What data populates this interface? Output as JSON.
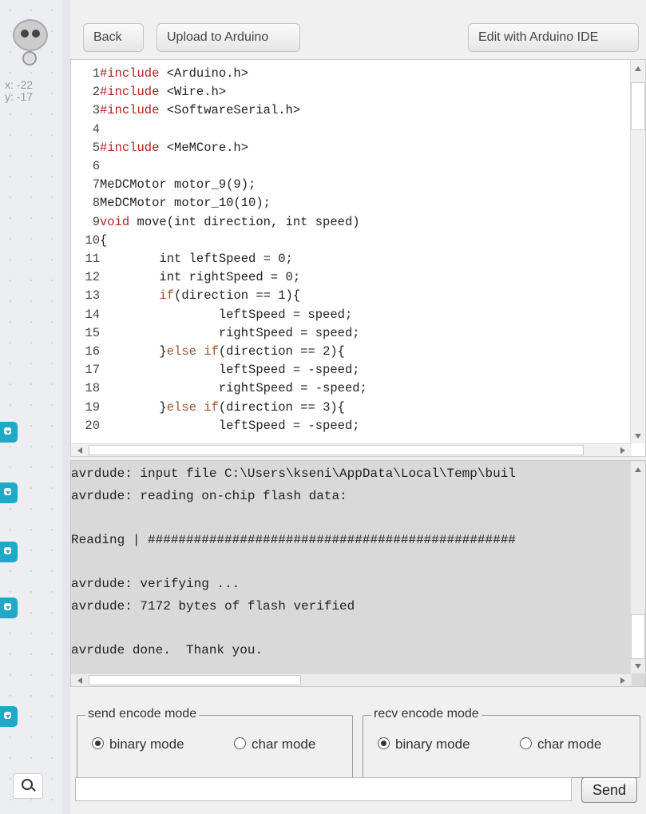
{
  "sprite": {
    "x_readout": "x: -22",
    "y_readout": "y: -17"
  },
  "toolbar": {
    "back_label": "Back",
    "upload_label": "Upload to Arduino",
    "edit_label": "Edit with Arduino IDE"
  },
  "code_lines": [
    {
      "n": "1",
      "tokens": [
        {
          "t": "#include",
          "c": "kw"
        },
        {
          "t": " <Arduino.h>",
          "c": ""
        }
      ]
    },
    {
      "n": "2",
      "tokens": [
        {
          "t": "#include",
          "c": "kw"
        },
        {
          "t": " <Wire.h>",
          "c": ""
        }
      ]
    },
    {
      "n": "3",
      "tokens": [
        {
          "t": "#include",
          "c": "kw"
        },
        {
          "t": " <SoftwareSerial.h>",
          "c": ""
        }
      ]
    },
    {
      "n": "4",
      "tokens": []
    },
    {
      "n": "5",
      "tokens": [
        {
          "t": "#include",
          "c": "kw"
        },
        {
          "t": " <MeMCore.h>",
          "c": ""
        }
      ]
    },
    {
      "n": "6",
      "tokens": []
    },
    {
      "n": "7",
      "tokens": [
        {
          "t": "MeDCMotor motor_9(9);",
          "c": ""
        }
      ]
    },
    {
      "n": "8",
      "tokens": [
        {
          "t": "MeDCMotor motor_10(10);",
          "c": ""
        }
      ]
    },
    {
      "n": "9",
      "tokens": [
        {
          "t": "void",
          "c": "kw"
        },
        {
          "t": " move(int direction, int speed)",
          "c": ""
        }
      ]
    },
    {
      "n": "10",
      "tokens": [
        {
          "t": "{",
          "c": ""
        }
      ]
    },
    {
      "n": "11",
      "tokens": [
        {
          "t": "        int leftSpeed = 0;",
          "c": ""
        }
      ]
    },
    {
      "n": "12",
      "tokens": [
        {
          "t": "        int rightSpeed = 0;",
          "c": ""
        }
      ]
    },
    {
      "n": "13",
      "tokens": [
        {
          "t": "        ",
          "c": ""
        },
        {
          "t": "if",
          "c": "ctl"
        },
        {
          "t": "(direction == 1){",
          "c": ""
        }
      ]
    },
    {
      "n": "14",
      "tokens": [
        {
          "t": "                leftSpeed = speed;",
          "c": ""
        }
      ]
    },
    {
      "n": "15",
      "tokens": [
        {
          "t": "                rightSpeed = speed;",
          "c": ""
        }
      ]
    },
    {
      "n": "16",
      "tokens": [
        {
          "t": "        }",
          "c": ""
        },
        {
          "t": "else if",
          "c": "ctl"
        },
        {
          "t": "(direction == 2){",
          "c": ""
        }
      ]
    },
    {
      "n": "17",
      "tokens": [
        {
          "t": "                leftSpeed = -speed;",
          "c": ""
        }
      ]
    },
    {
      "n": "18",
      "tokens": [
        {
          "t": "                rightSpeed = -speed;",
          "c": ""
        }
      ]
    },
    {
      "n": "19",
      "tokens": [
        {
          "t": "        }",
          "c": ""
        },
        {
          "t": "else if",
          "c": "ctl"
        },
        {
          "t": "(direction == 3){",
          "c": ""
        }
      ]
    },
    {
      "n": "20",
      "tokens": [
        {
          "t": "                leftSpeed = -speed;",
          "c": ""
        }
      ]
    }
  ],
  "console_lines": [
    "avrdude: input file C:\\Users\\kseni\\AppData\\Local\\Temp\\buil",
    "avrdude: reading on-chip flash data:",
    "",
    "Reading | ################################################",
    "",
    "avrdude: verifying ...",
    "avrdude: 7172 bytes of flash verified",
    "",
    "avrdude done.  Thank you."
  ],
  "send_mode": {
    "legend": "send encode mode",
    "binary_label": "binary mode",
    "char_label": "char mode",
    "selected": "binary"
  },
  "recv_mode": {
    "legend": "recv encode mode",
    "binary_label": "binary mode",
    "char_label": "char mode",
    "selected": "binary"
  },
  "send_input": {
    "value": "",
    "placeholder": ""
  },
  "send_button": "Send",
  "colors": {
    "keyword": "#b22222",
    "control": "#a0522d",
    "tab_accent": "#1fa9c9",
    "console_bg": "#d9d9d9"
  },
  "icons": [
    "panda-sprite-icon",
    "block-tab-icon",
    "zoom-in-icon"
  ]
}
